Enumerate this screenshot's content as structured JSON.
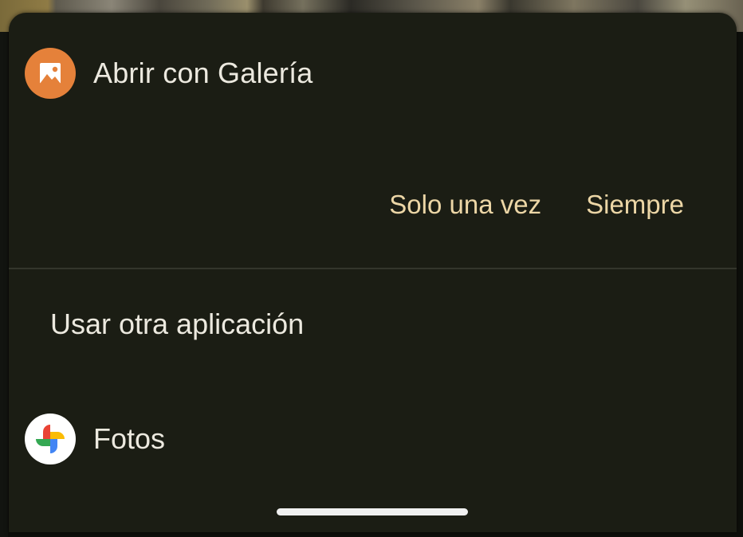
{
  "dialog": {
    "title": "Abrir con Galería",
    "app_icon": "galeria-gallery-icon",
    "actions": {
      "once_label": "Solo una vez",
      "always_label": "Siempre"
    },
    "other_apps": {
      "heading": "Usar otra aplicación",
      "items": [
        {
          "label": "Fotos",
          "icon": "google-photos-pinwheel-icon"
        }
      ]
    }
  },
  "colors": {
    "sheet_background": "#1b1d14",
    "accent_text": "#ecd6a6",
    "primary_text": "#ece9df",
    "galeria_icon_bg": "#e5813a"
  }
}
